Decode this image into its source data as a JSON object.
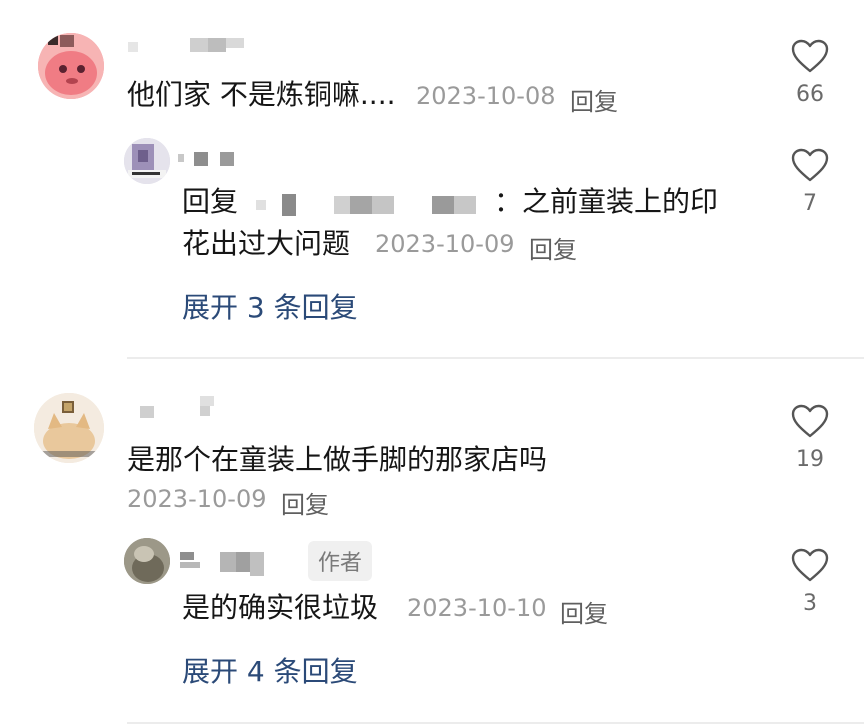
{
  "comments": [
    {
      "text": "他们家 不是炼铜嘛....",
      "date": "2023-10-08",
      "reply_label": "回复",
      "likes": "66",
      "replies": [
        {
          "prefix": "回复",
          "suffix": "：之前童装上的印",
          "text_line2": "花出过大问题",
          "date": "2023-10-09",
          "reply_label": "回复",
          "likes": "7"
        }
      ],
      "expand_label": "展开 3 条回复"
    },
    {
      "text": "是那个在童装上做手脚的那家店吗",
      "date": "2023-10-09",
      "reply_label": "回复",
      "likes": "19",
      "replies": [
        {
          "author_tag": "作者",
          "text": "是的确实很垃圾",
          "date": "2023-10-10",
          "reply_label": "回复",
          "likes": "3"
        }
      ],
      "expand_label": "展开 4 条回复"
    }
  ],
  "colors": {
    "expand": "#2b4a78",
    "meta": "#9a9a9a",
    "divider": "#ececec"
  },
  "icons": {
    "like": "heart-outline-icon"
  }
}
